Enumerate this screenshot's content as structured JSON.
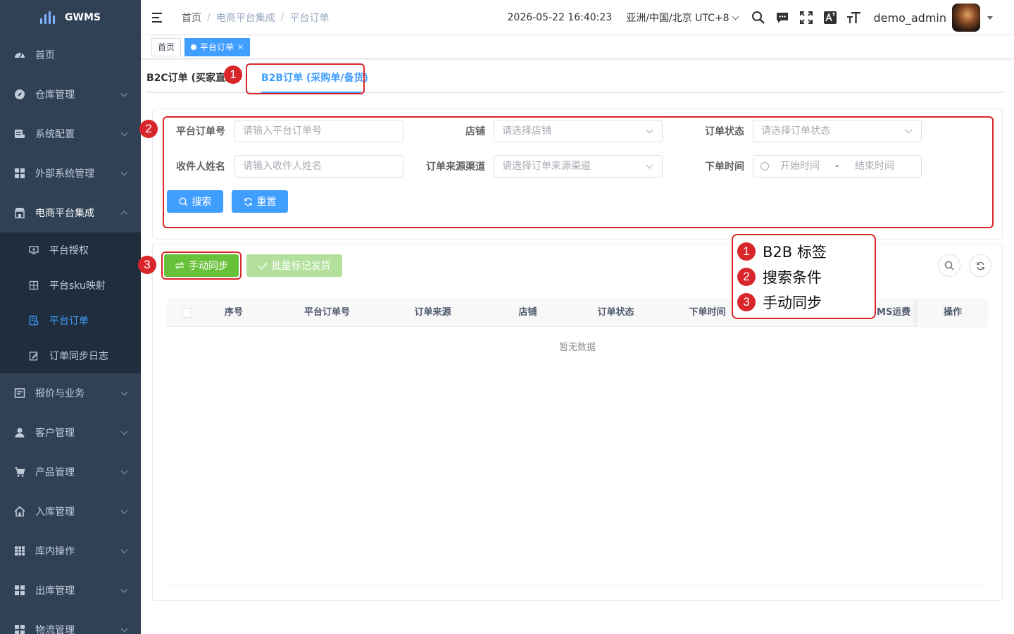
{
  "app": {
    "name": "GWMS"
  },
  "sidebar": {
    "items": [
      {
        "label": "首页",
        "icon": "dashboard-icon"
      },
      {
        "label": "仓库管理",
        "icon": "compass-icon"
      },
      {
        "label": "系统配置",
        "icon": "list-icon"
      },
      {
        "label": "外部系统管理",
        "icon": "grid-icon"
      },
      {
        "label": "电商平台集成",
        "icon": "shop-icon",
        "expanded": true
      },
      {
        "label": "报价与业务",
        "icon": "quote-icon"
      },
      {
        "label": "客户管理",
        "icon": "user-icon"
      },
      {
        "label": "产品管理",
        "icon": "cart-icon"
      },
      {
        "label": "入库管理",
        "icon": "home-icon"
      },
      {
        "label": "库内操作",
        "icon": "table-icon"
      },
      {
        "label": "出库管理",
        "icon": "grid-icon"
      },
      {
        "label": "物流管理",
        "icon": "grid-icon"
      }
    ],
    "sub_items": [
      {
        "label": "平台授权",
        "icon": "monitor-icon"
      },
      {
        "label": "平台sku映射",
        "icon": "mapping-icon"
      },
      {
        "label": "平台订单",
        "icon": "document-icon",
        "active": true
      },
      {
        "label": "订单同步日志",
        "icon": "edit-icon"
      }
    ]
  },
  "header": {
    "breadcrumb": [
      "首页",
      "电商平台集成",
      "平台订单"
    ],
    "separator": "/",
    "datetime": "2026-05-22 16:40:23",
    "timezone": "亚洲/中国/北京 UTC+8",
    "username": "demo_admin"
  },
  "tags_view": {
    "tags": [
      {
        "label": "首页",
        "active": false
      },
      {
        "label": "平台订单",
        "active": true,
        "close": "×"
      }
    ]
  },
  "tabs": [
    {
      "label": "B2C订单 (买家直发)",
      "active": false
    },
    {
      "label": "B2B订单 (采购单/备货)",
      "active": true
    }
  ],
  "search_form": {
    "order_no": {
      "label": "平台订单号",
      "placeholder": "请输入平台订单号"
    },
    "shop": {
      "label": "店铺",
      "placeholder": "请选择店铺"
    },
    "order_status": {
      "label": "订单状态",
      "placeholder": "请选择订单状态"
    },
    "receiver": {
      "label": "收件人姓名",
      "placeholder": "请输入收件人姓名"
    },
    "source_channel": {
      "label": "订单来源渠道",
      "placeholder": "请选择订单来源渠道"
    },
    "order_time": {
      "label": "下单时间",
      "start_placeholder": "开始时间",
      "separator": "-",
      "end_placeholder": "结束时间"
    },
    "search_button": "搜索",
    "reset_button": "重置"
  },
  "toolbar": {
    "sync_button": "手动同步",
    "batch_ship_button": "批量标记发货"
  },
  "table": {
    "columns": [
      "序号",
      "平台订单号",
      "订单来源",
      "店铺",
      "订单状态",
      "下单时间",
      "WMS运费",
      "操作"
    ],
    "empty_text": "暂无数据"
  },
  "annotations": {
    "markers": [
      "1",
      "2",
      "3"
    ],
    "legend": [
      {
        "num": "1",
        "text": "B2B 标签"
      },
      {
        "num": "2",
        "text": "搜索条件"
      },
      {
        "num": "3",
        "text": "手动同步"
      }
    ]
  },
  "colors": {
    "sidebar_bg": "#304156",
    "submenu_bg": "#1f2d3d",
    "primary": "#409eff",
    "success": "#67c23a",
    "annotation_red": "#d9262a"
  }
}
